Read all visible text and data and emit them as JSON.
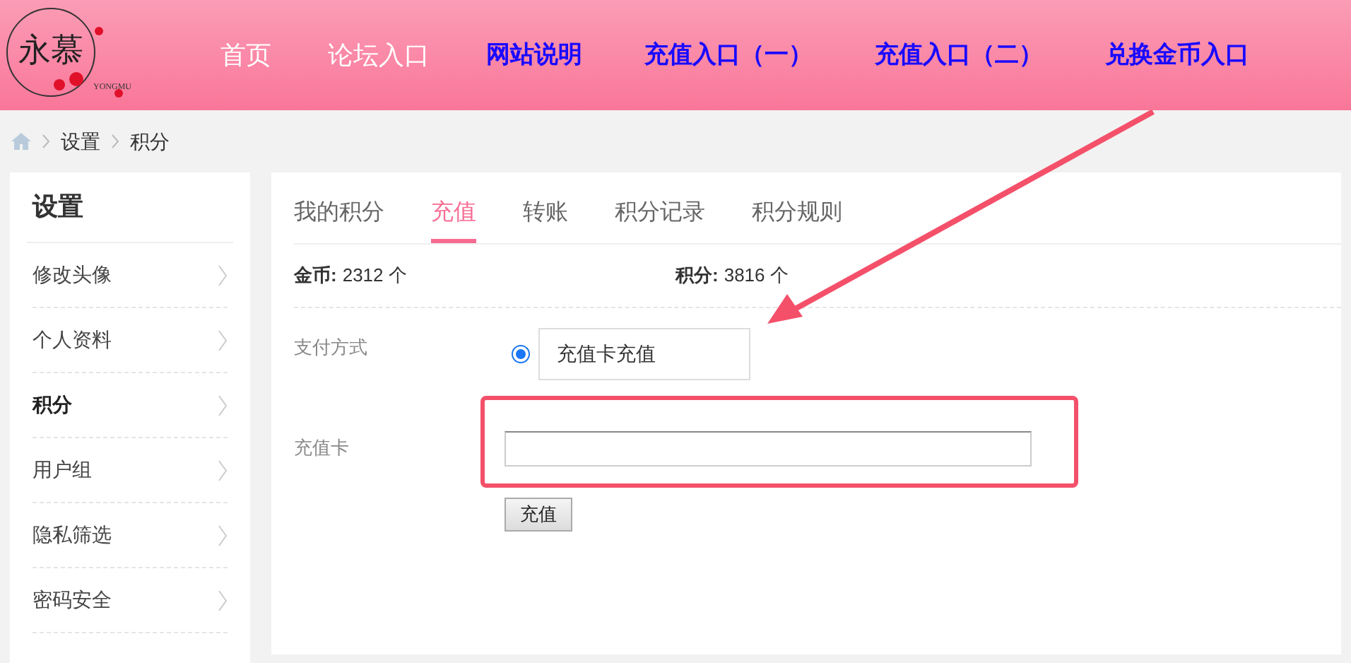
{
  "logo": {
    "title": "永慕",
    "subtitle": "YONGMU"
  },
  "nav": [
    {
      "label": "首页",
      "kind": "plain"
    },
    {
      "label": "论坛入口",
      "kind": "plain"
    },
    {
      "label": "网站说明",
      "kind": "bold"
    },
    {
      "label": "充值入口（一）",
      "kind": "bold"
    },
    {
      "label": "充值入口（二）",
      "kind": "bold"
    },
    {
      "label": "兑换金币入口",
      "kind": "bold"
    }
  ],
  "breadcrumb": [
    "设置",
    "积分"
  ],
  "sidebar": {
    "title": "设置",
    "items": [
      {
        "label": "修改头像",
        "selected": false
      },
      {
        "label": "个人资料",
        "selected": false
      },
      {
        "label": "积分",
        "selected": true
      },
      {
        "label": "用户组",
        "selected": false
      },
      {
        "label": "隐私筛选",
        "selected": false
      },
      {
        "label": "密码安全",
        "selected": false
      }
    ]
  },
  "tabs": [
    {
      "label": "我的积分",
      "selected": false
    },
    {
      "label": "充值",
      "selected": true
    },
    {
      "label": "转账",
      "selected": false
    },
    {
      "label": "积分记录",
      "selected": false
    },
    {
      "label": "积分规则",
      "selected": false
    }
  ],
  "stats": [
    {
      "label": "金币:",
      "value": "2312 个"
    },
    {
      "label": "积分:",
      "value": "3816 个"
    }
  ],
  "payment": {
    "label": "支付方式",
    "option": "充值卡充值",
    "selected": true
  },
  "card": {
    "label": "充值卡"
  },
  "submit": "充值"
}
